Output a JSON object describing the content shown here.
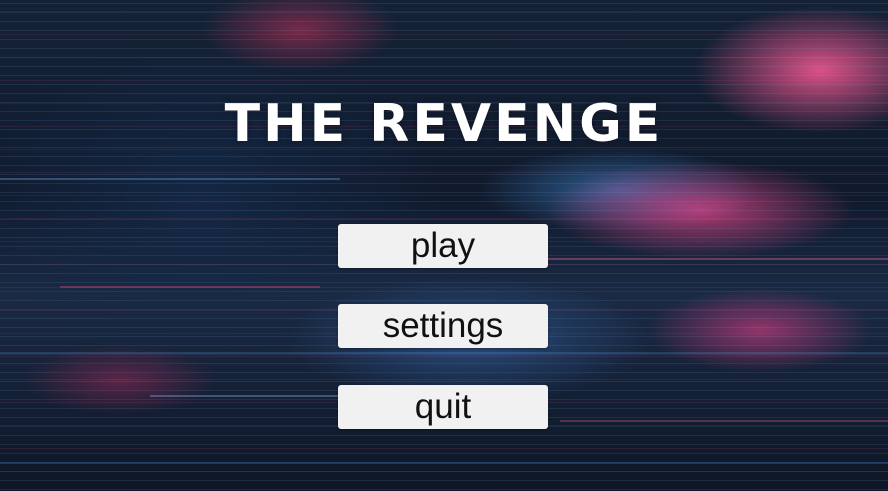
{
  "game": {
    "title": "THE REVENGE"
  },
  "menu": {
    "play_label": "play",
    "settings_label": "settings",
    "quit_label": "quit"
  },
  "colors": {
    "button_background": "#f1f1f1",
    "button_text": "#111111",
    "title_text": "#ffffff",
    "background_accent_pink": "#ff5a96",
    "background_accent_blue": "#4696e6",
    "background_base": "#101a2c"
  }
}
